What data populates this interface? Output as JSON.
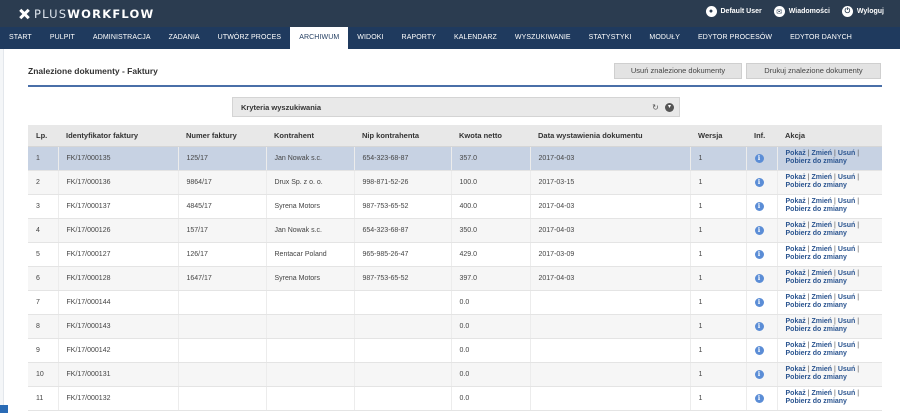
{
  "app": {
    "logo_prefix": "PLUS",
    "logo_suffix": "WORKFLOW",
    "user_actions": [
      {
        "label": "Default User",
        "icon": "user-icon",
        "glyph": "●"
      },
      {
        "label": "Wiadomości",
        "icon": "mail-icon",
        "glyph": "✉"
      },
      {
        "label": "Wyloguj",
        "icon": "power-icon",
        "glyph": "⏻"
      }
    ]
  },
  "nav": {
    "items": [
      "START",
      "PULPIT",
      "ADMINISTRACJA",
      "ZADANIA",
      "UTWÓRZ PROCES",
      "ARCHIWUM",
      "WIDOKI",
      "RAPORTY",
      "KALENDARZ",
      "WYSZUKIWANIE",
      "STATYSTYKI",
      "MODUŁY",
      "EDYTOR PROCESÓW",
      "EDYTOR DANYCH"
    ],
    "active": "ARCHIWUM"
  },
  "page": {
    "title": "Znalezione dokumenty - Faktury",
    "btn_remove": "Usuń znalezione dokumenty",
    "btn_print": "Drukuj znalezione dokumenty"
  },
  "criteria": {
    "label": "Kryteria wyszukiwania",
    "refresh_glyph": "↻",
    "toggle_glyph": "▾"
  },
  "table": {
    "columns": [
      "Lp.",
      "Identyfikator faktury",
      "Numer faktury",
      "Kontrahent",
      "Nip kontrahenta",
      "Kwota netto",
      "Data wystawienia dokumentu",
      "Wersja",
      "Inf.",
      "Akcja"
    ],
    "info_glyph": "i",
    "actions": {
      "show": "Pokaż",
      "edit": "Zmień",
      "delete": "Usuń",
      "fetch": "Pobierz do zmiany",
      "sep": "|"
    },
    "rows": [
      {
        "lp": "1",
        "id": "FK/17/000135",
        "num": "125/17",
        "contractor": "Jan Nowak s.c.",
        "nip": "654-323-68-87",
        "net": "357.0",
        "date": "2017-04-03",
        "version": "1"
      },
      {
        "lp": "2",
        "id": "FK/17/000136",
        "num": "9864/17",
        "contractor": "Drux Sp. z o. o.",
        "nip": "998-871-52-26",
        "net": "100.0",
        "date": "2017-03-15",
        "version": "1"
      },
      {
        "lp": "3",
        "id": "FK/17/000137",
        "num": "4845/17",
        "contractor": "Syrena Motors",
        "nip": "987-753-65-52",
        "net": "400.0",
        "date": "2017-04-03",
        "version": "1"
      },
      {
        "lp": "4",
        "id": "FK/17/000126",
        "num": "157/17",
        "contractor": "Jan Nowak s.c.",
        "nip": "654-323-68-87",
        "net": "350.0",
        "date": "2017-04-03",
        "version": "1"
      },
      {
        "lp": "5",
        "id": "FK/17/000127",
        "num": "126/17",
        "contractor": "Rentacar Poland",
        "nip": "965-985-26-47",
        "net": "429.0",
        "date": "2017-03-09",
        "version": "1"
      },
      {
        "lp": "6",
        "id": "FK/17/000128",
        "num": "1647/17",
        "contractor": "Syrena Motors",
        "nip": "987-753-65-52",
        "net": "397.0",
        "date": "2017-04-03",
        "version": "1"
      },
      {
        "lp": "7",
        "id": "FK/17/000144",
        "num": "",
        "contractor": "",
        "nip": "",
        "net": "0.0",
        "date": "",
        "version": "1"
      },
      {
        "lp": "8",
        "id": "FK/17/000143",
        "num": "",
        "contractor": "",
        "nip": "",
        "net": "0.0",
        "date": "",
        "version": "1"
      },
      {
        "lp": "9",
        "id": "FK/17/000142",
        "num": "",
        "contractor": "",
        "nip": "",
        "net": "0.0",
        "date": "",
        "version": "1"
      },
      {
        "lp": "10",
        "id": "FK/17/000131",
        "num": "",
        "contractor": "",
        "nip": "",
        "net": "0.0",
        "date": "",
        "version": "1"
      },
      {
        "lp": "11",
        "id": "FK/17/000132",
        "num": "",
        "contractor": "",
        "nip": "",
        "net": "0.0",
        "date": "",
        "version": "1"
      }
    ],
    "selected_row": 0
  }
}
